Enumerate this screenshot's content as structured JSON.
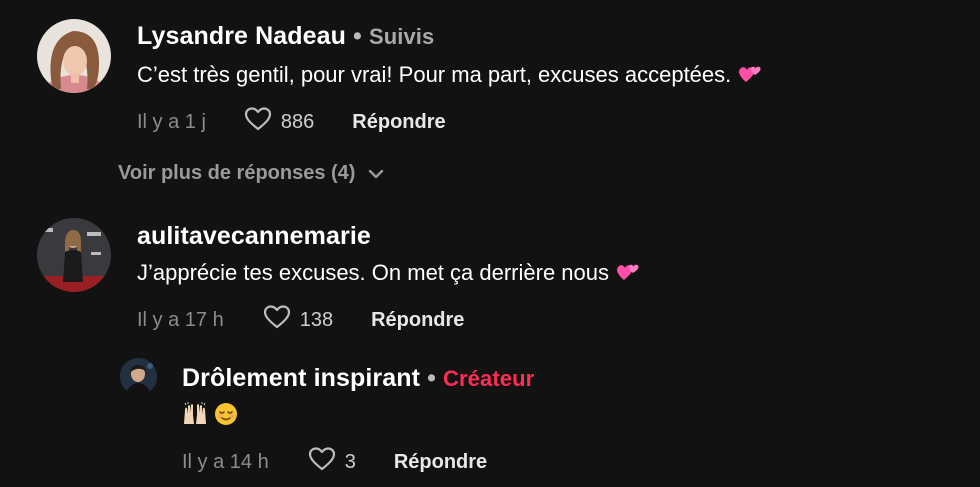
{
  "comments": [
    {
      "username": "Lysandre Nadeau",
      "separator": "•",
      "badge": "Suivis",
      "text": "C’est très gentil, pour vrai! Pour ma part, excuses acceptées.",
      "time": "Il y a 1 j",
      "likes": "886",
      "reply_label": "Répondre"
    },
    {
      "username": "aulitavecannemarie",
      "text": "J’apprécie tes excuses. On met ça derrière nous",
      "time": "Il y a 17 h",
      "likes": "138",
      "reply_label": "Répondre"
    },
    {
      "username": "Drôlement inspirant",
      "separator": "•",
      "badge": "Créateur",
      "text": "",
      "time": "Il y a 14 h",
      "likes": "3",
      "reply_label": "Répondre"
    }
  ],
  "more_replies_label": "Voir plus de réponses (4)",
  "icons": {
    "like": "heart-outline-icon",
    "expand": "chevron-down-icon",
    "emoji_hearts": "two-hearts-emoji",
    "emoji_hands": "raising-hands-emoji",
    "emoji_relieved": "relieved-face-emoji"
  },
  "colors": {
    "background": "#121212",
    "creator_badge": "#fe2c55",
    "follow_badge": "#a9a9a9"
  }
}
